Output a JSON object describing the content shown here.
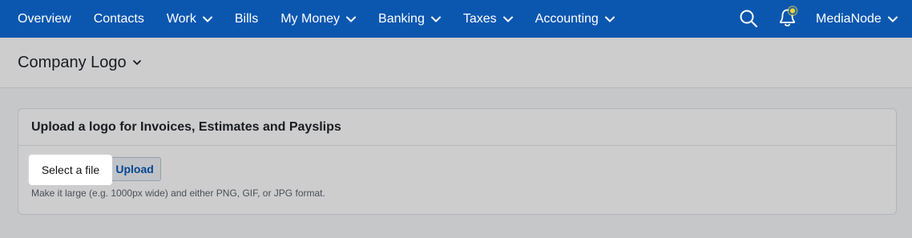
{
  "nav": {
    "items": [
      {
        "label": "Overview",
        "dropdown": false
      },
      {
        "label": "Contacts",
        "dropdown": false
      },
      {
        "label": "Work",
        "dropdown": true
      },
      {
        "label": "Bills",
        "dropdown": false
      },
      {
        "label": "My Money",
        "dropdown": true
      },
      {
        "label": "Banking",
        "dropdown": true
      },
      {
        "label": "Taxes",
        "dropdown": true
      },
      {
        "label": "Accounting",
        "dropdown": true
      }
    ],
    "account_label": "MediaNode",
    "icons": {
      "search": "search-icon",
      "notifications": "bell-icon",
      "chevron": "chevron-down-icon"
    },
    "colors": {
      "nav_bg": "#0b57b0",
      "notification_dot": "#e8d33a"
    }
  },
  "page": {
    "title": "Company Logo"
  },
  "upload_card": {
    "heading": "Upload a logo for Invoices, Estimates and Payslips",
    "select_button": "Select a file",
    "upload_button": "Upload",
    "help_text": "Make it large (e.g. 1000px wide) and either PNG, GIF, or JPG format."
  }
}
